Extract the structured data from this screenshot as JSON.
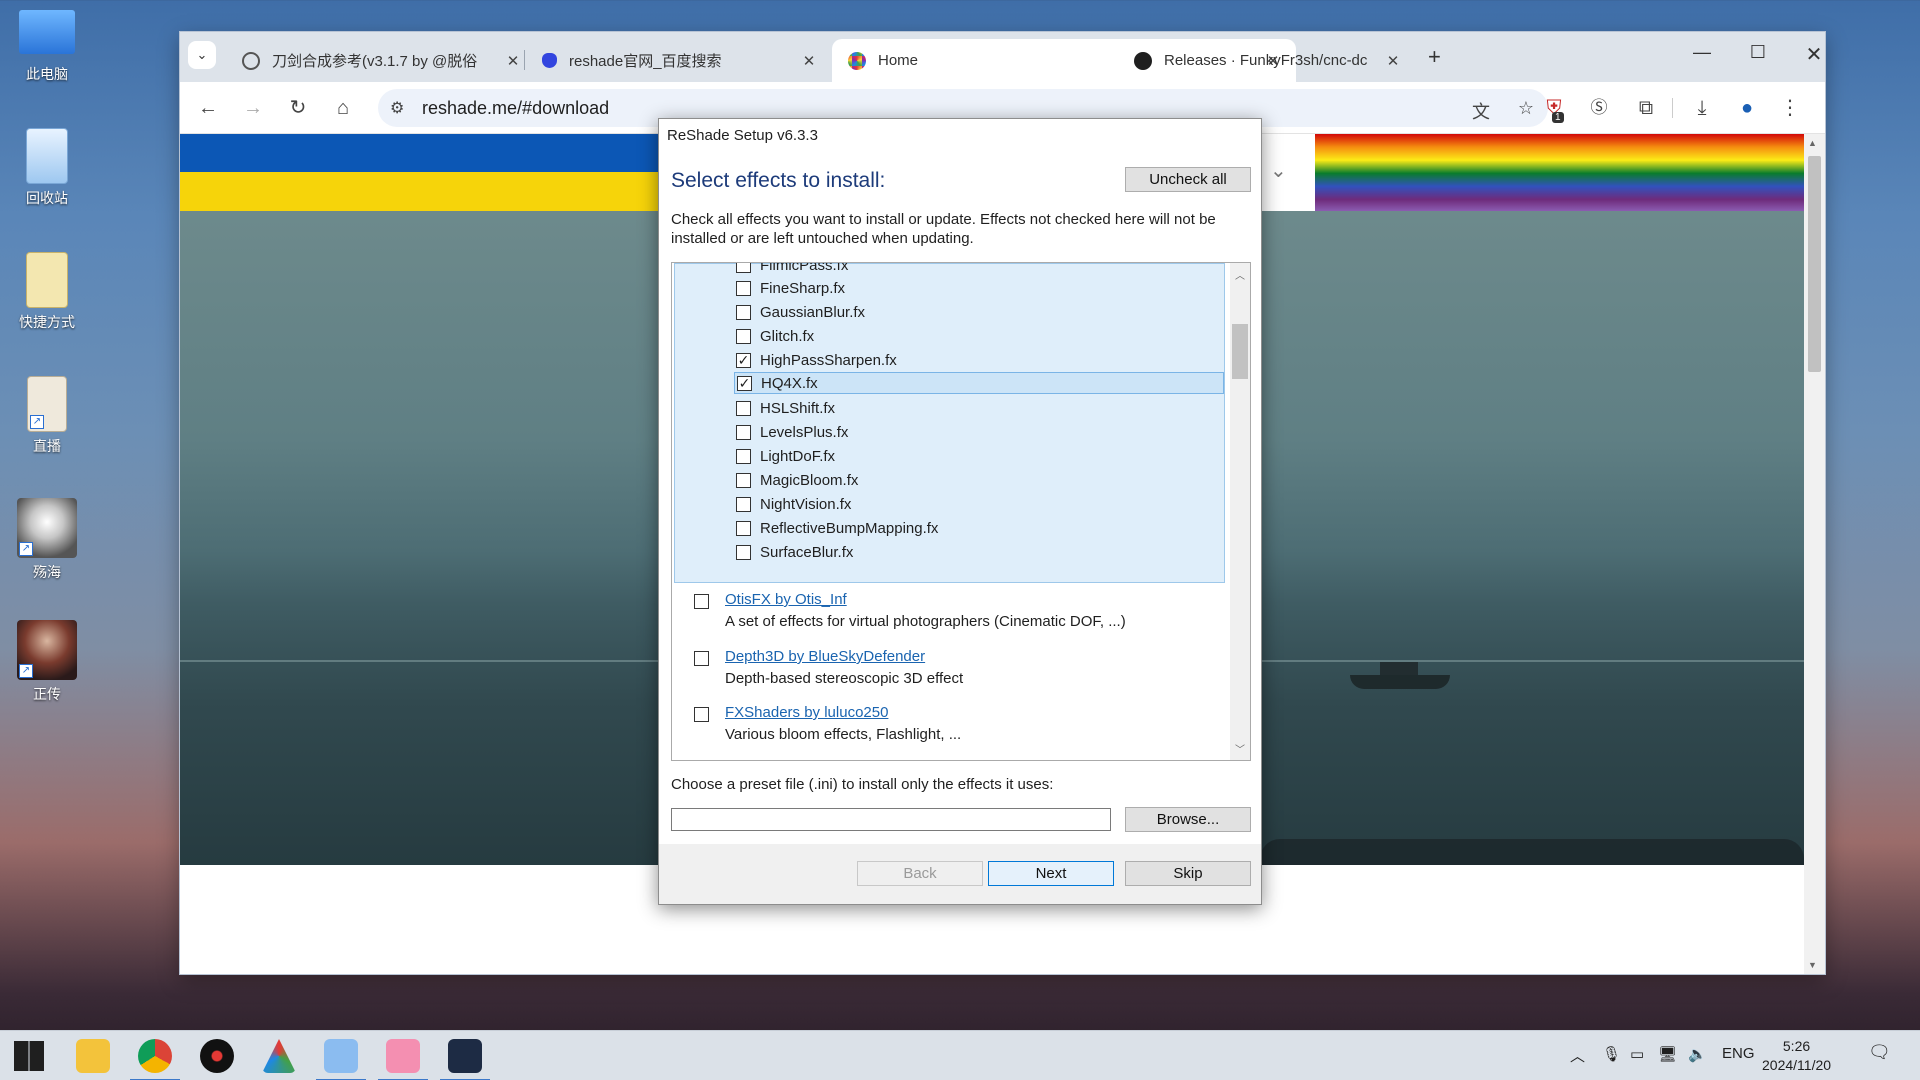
{
  "desktop": {
    "icons": [
      {
        "label": "此电脑",
        "icon": "computer-icon"
      },
      {
        "label": "回收站",
        "icon": "recycle-bin-icon"
      },
      {
        "label": "快捷方式",
        "icon": "folder-shortcut-icon"
      },
      {
        "label": "直播",
        "icon": "app-shortcut-icon"
      },
      {
        "label": "殇海",
        "icon": "app-shortcut-icon"
      },
      {
        "label": "正传",
        "icon": "game-shortcut-icon"
      }
    ]
  },
  "browser": {
    "tabs": [
      {
        "title": "刀剑合成参考(v3.1.7 by @脱俗",
        "icon": "globe-icon",
        "active": false
      },
      {
        "title": "reshade官网_百度搜索",
        "icon": "baidu-paw-icon",
        "active": false
      },
      {
        "title": "Home",
        "icon": "reshade-logo-icon",
        "active": true
      },
      {
        "title": "Releases · FunkyFr3sh/cnc-dc",
        "icon": "github-icon",
        "active": false
      }
    ],
    "new_tab": "+",
    "url": "reshade.me/#download",
    "extension_badge": "1"
  },
  "dialog": {
    "title": "ReShade Setup v6.3.3",
    "heading": "Select effects to install:",
    "uncheck_all": "Uncheck all",
    "description": "Check all effects you want to install or update. Effects not checked here will not be installed or are left untouched when updating.",
    "files": [
      {
        "name": "FilmicPass.fx",
        "checked": false
      },
      {
        "name": "FineSharp.fx",
        "checked": false
      },
      {
        "name": "GaussianBlur.fx",
        "checked": false
      },
      {
        "name": "Glitch.fx",
        "checked": false
      },
      {
        "name": "HighPassSharpen.fx",
        "checked": true
      },
      {
        "name": "HQ4X.fx",
        "checked": true,
        "selected": true
      },
      {
        "name": "HSLShift.fx",
        "checked": false
      },
      {
        "name": "LevelsPlus.fx",
        "checked": false
      },
      {
        "name": "LightDoF.fx",
        "checked": false
      },
      {
        "name": "MagicBloom.fx",
        "checked": false
      },
      {
        "name": "NightVision.fx",
        "checked": false
      },
      {
        "name": "ReflectiveBumpMapping.fx",
        "checked": false
      },
      {
        "name": "SurfaceBlur.fx",
        "checked": false
      }
    ],
    "packages": [
      {
        "name": "OtisFX by Otis_Inf",
        "description": "A set of effects for virtual photographers (Cinematic DOF, ...)",
        "checked": false
      },
      {
        "name": "Depth3D by BlueSkyDefender",
        "description": "Depth-based stereoscopic 3D effect",
        "checked": false
      },
      {
        "name": "FXShaders by luluco250",
        "description": "Various bloom effects, Flashlight, ...",
        "checked": false
      }
    ],
    "preset_label": "Choose a preset file (.ini) to install only the effects it uses:",
    "preset_value": "",
    "browse": "Browse...",
    "back": "Back",
    "next": "Next",
    "skip": "Skip"
  },
  "taskbar": {
    "language": "ENG",
    "time": "5:26",
    "date": "2024/11/20"
  }
}
